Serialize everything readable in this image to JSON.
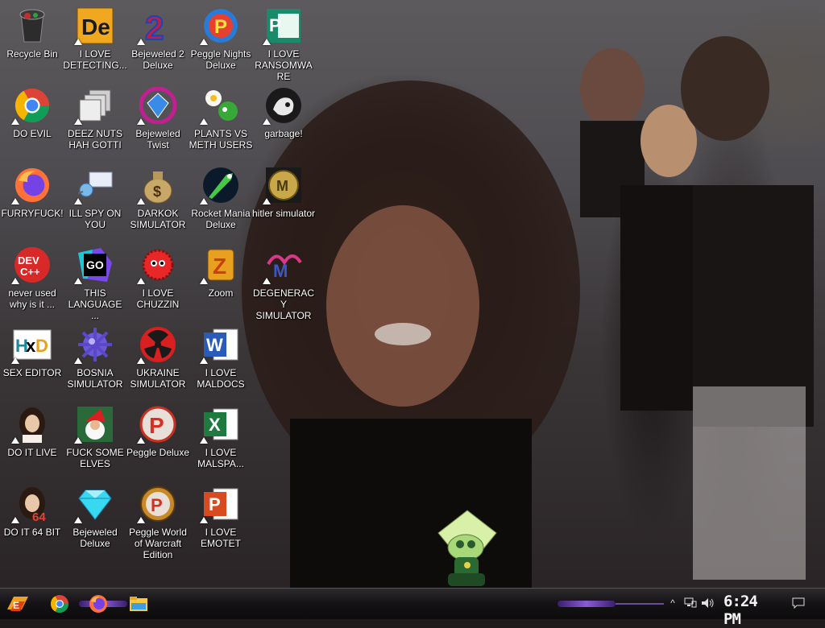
{
  "desktop": {
    "icons": [
      {
        "label": "Recycle Bin",
        "icon": "recycle-bin-icon"
      },
      {
        "label": "I LOVE DETECTING...",
        "icon": "die-icon"
      },
      {
        "label": "Bejeweled 2 Deluxe",
        "icon": "bejeweled2-icon"
      },
      {
        "label": "Peggle Nights Deluxe",
        "icon": "peggle-nights-icon"
      },
      {
        "label": "I LOVE RANSOMWARE",
        "icon": "publisher-icon"
      },
      {
        "label": "DO EVIL",
        "icon": "chrome-icon"
      },
      {
        "label": "DEEZ NUTS HAH GOTTI",
        "icon": "windows-stack-icon"
      },
      {
        "label": "Bejeweled Twist",
        "icon": "bejeweled-twist-icon"
      },
      {
        "label": "PLANTS VS METH USERS",
        "icon": "plants-icon"
      },
      {
        "label": "garbage!",
        "icon": "garbage-icon"
      },
      {
        "label": "FURRYFUCK!",
        "icon": "firefox-icon"
      },
      {
        "label": "ILL SPY ON YOU",
        "icon": "spy-icon"
      },
      {
        "label": "DARKOK SIMULATOR",
        "icon": "money-bag-icon"
      },
      {
        "label": "Rocket Mania Deluxe",
        "icon": "rocket-mania-icon"
      },
      {
        "label": "hitler simulator",
        "icon": "coin-icon"
      },
      {
        "label": "never used why is it ...",
        "icon": "devcpp-icon"
      },
      {
        "label": "THIS LANGUAGE ...",
        "icon": "goland-icon"
      },
      {
        "label": "I LOVE CHUZZIN",
        "icon": "chuzzle-icon"
      },
      {
        "label": "Zoom",
        "icon": "zuma-icon"
      },
      {
        "label": "DEGENERACY SIMULATOR",
        "icon": "degeneracy-icon"
      },
      {
        "label": "SEX EDITOR",
        "icon": "hxd-icon"
      },
      {
        "label": "BOSNIA SIMULATOR",
        "icon": "mine-icon"
      },
      {
        "label": "UKRAINE SIMULATOR",
        "icon": "radiation-icon"
      },
      {
        "label": "I LOVE MALDOCS",
        "icon": "word-icon"
      },
      {
        "label": "DO IT LIVE",
        "icon": "portrait-icon"
      },
      {
        "label": "FUCK SOME ELVES",
        "icon": "santa-icon"
      },
      {
        "label": "Peggle Deluxe",
        "icon": "peggle-icon"
      },
      {
        "label": "I LOVE MALSPA...",
        "icon": "excel-icon"
      },
      {
        "label": "DO IT 64 BIT",
        "icon": "portrait64-icon"
      },
      {
        "label": "Bejeweled Deluxe",
        "icon": "diamond-icon"
      },
      {
        "label": "Peggle World of Warcraft Edition",
        "icon": "peggle-wow-icon"
      },
      {
        "label": "I LOVE EMOTET",
        "icon": "powerpoint-icon"
      }
    ],
    "colors": {
      "label": "#ffffff",
      "accent": "#8a5ad8"
    }
  },
  "taskbar": {
    "pinned": [
      {
        "icon": "start-icon"
      },
      {
        "icon": "chrome-icon"
      },
      {
        "icon": "firefox-icon"
      },
      {
        "icon": "file-explorer-icon"
      }
    ],
    "tray": {
      "chevron": "^",
      "network_icon": "network-icon",
      "volume_icon": "volume-icon",
      "notification_icon": "notification-icon"
    },
    "clock": "6:24 PM"
  }
}
